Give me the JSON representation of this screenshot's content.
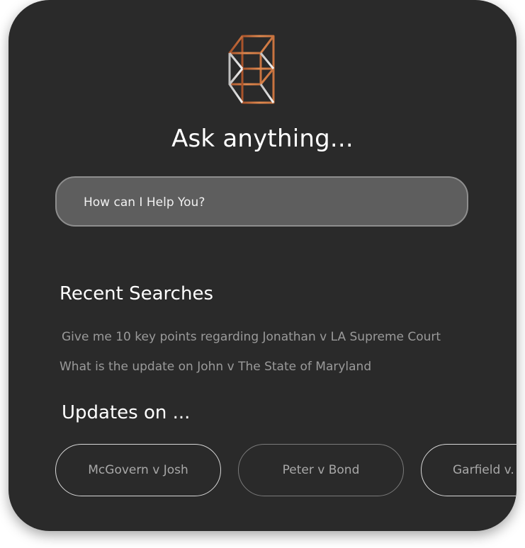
{
  "brand": {
    "logo_icon": "isometric-cube-logo-icon",
    "colors": {
      "card_background": "#2a2a2a",
      "logo_copper": "#c8733f",
      "logo_silver": "#d9d9d9",
      "input_background": "#5e5e5e"
    }
  },
  "header": {
    "title": "Ask anything..."
  },
  "search": {
    "placeholder": "How can I Help You?",
    "value": ""
  },
  "recent_searches": {
    "title": "Recent Searches",
    "items": [
      "Give me 10 key points regarding Jonathan v LA Supreme Court",
      "What is the update on John v The State of Maryland"
    ]
  },
  "updates": {
    "title": "Updates on ...",
    "cases": [
      "McGovern v Josh",
      "Peter v Bond",
      "Garfield v."
    ]
  }
}
